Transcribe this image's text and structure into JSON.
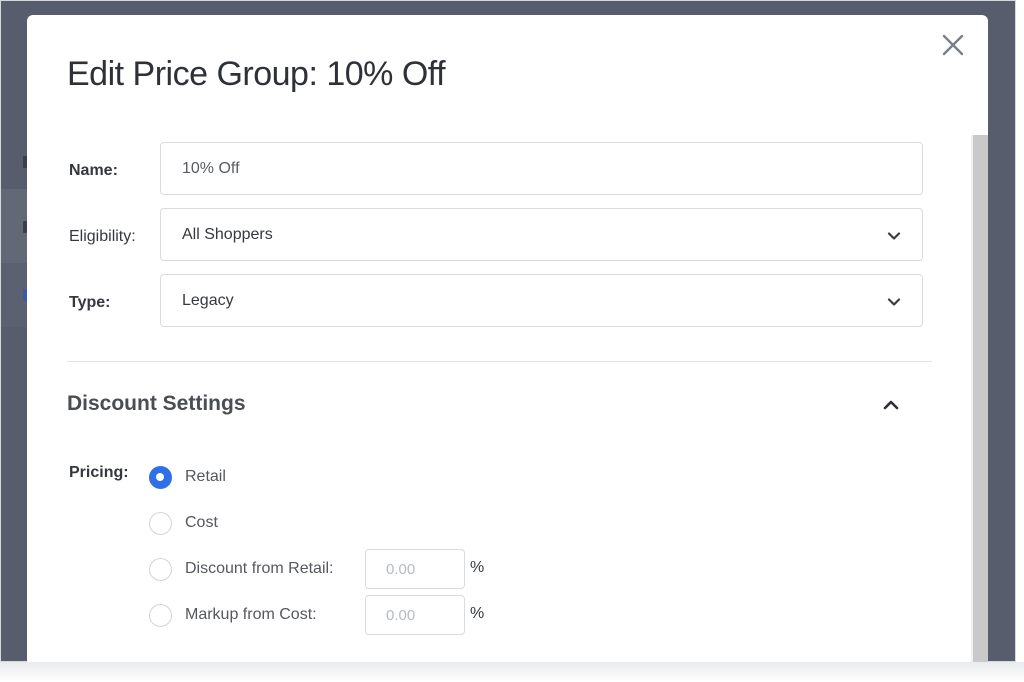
{
  "modal": {
    "title": "Edit Price Group: 10% Off"
  },
  "form": {
    "name_label": "Name:",
    "name_value": "10% Off",
    "eligibility_label": "Eligibility:",
    "eligibility_value": "All Shoppers",
    "type_label": "Type:",
    "type_value": "Legacy"
  },
  "discount_settings": {
    "title": "Discount Settings",
    "expanded": true,
    "pricing_label": "Pricing:",
    "options": [
      {
        "label": "Retail",
        "checked": true
      },
      {
        "label": "Cost",
        "checked": false
      },
      {
        "label": "Discount from Retail:",
        "checked": false,
        "placeholder": "0.00",
        "unit": "%"
      },
      {
        "label": "Markup from Cost:",
        "checked": false,
        "placeholder": "0.00",
        "unit": "%"
      }
    ]
  },
  "icons": {
    "close": "close-icon",
    "dropdown": "chevron-down-icon",
    "collapse": "chevron-up-icon"
  },
  "colors": {
    "accent": "#2f6fe8",
    "backdrop": "#575d6c"
  }
}
